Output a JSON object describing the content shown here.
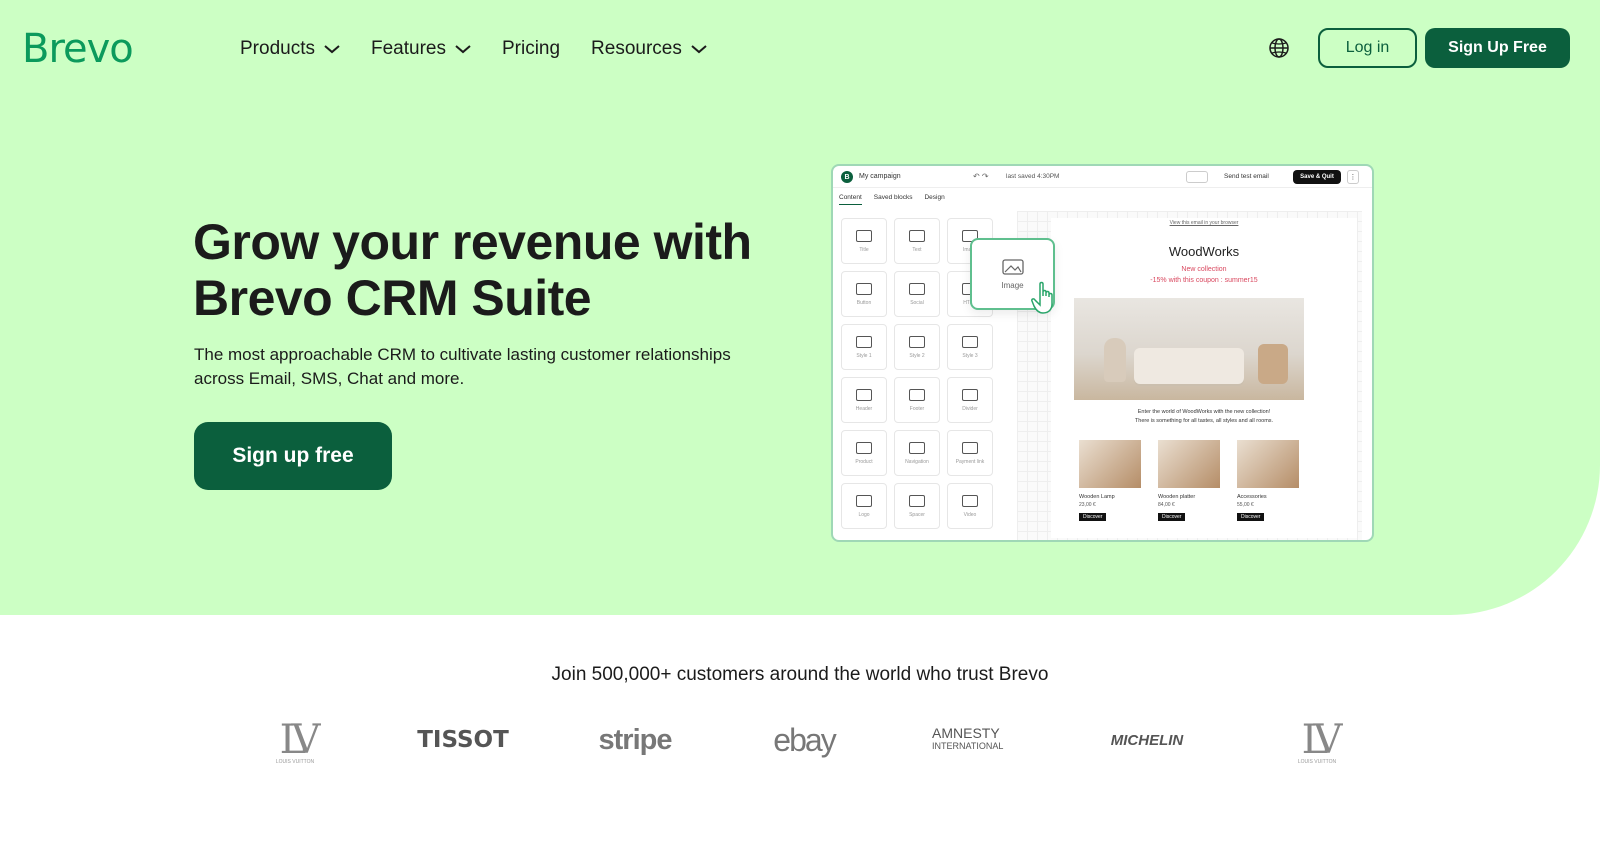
{
  "brand": {
    "logo_text": "Brevo",
    "accent": "#0b9a5c",
    "dark": "#0b5f3d",
    "hero_bg": "#ccffc4"
  },
  "nav": {
    "items": [
      {
        "label": "Products",
        "dropdown": true
      },
      {
        "label": "Features",
        "dropdown": true
      },
      {
        "label": "Pricing",
        "dropdown": false
      },
      {
        "label": "Resources",
        "dropdown": true
      }
    ],
    "globe_icon": "globe-icon",
    "login_label": "Log in",
    "signup_label": "Sign Up Free"
  },
  "hero": {
    "headline": "Grow your revenue with Brevo CRM Suite",
    "subtext": "The most approachable CRM to cultivate lasting customer relationships across Email, SMS, Chat and more.",
    "cta_label": "Sign up free"
  },
  "editor": {
    "badge": "B",
    "title": "My campaign",
    "last_saved": "last saved 4:30PM",
    "send_test": "Send test email",
    "save_quit": "Save & Quit",
    "more": "⋮",
    "tabs": [
      "Content",
      "Saved blocks",
      "Design"
    ],
    "blocks": [
      "Title",
      "Text",
      "Image",
      "Button",
      "Social",
      "HTML",
      "Style 1",
      "Style 2",
      "Style 3",
      "Header",
      "Footer",
      "Divider",
      "Product",
      "Navigation",
      "Payment link",
      "Logo",
      "Spacer",
      "Video"
    ],
    "drag_label": "Image",
    "email": {
      "view_link": "View this email in your browser",
      "brand_name": "WoodWorks",
      "promo_line1": "New collection",
      "promo_line2": "-15% with this coupon : summer15",
      "desc_line1": "Enter the world of WoodWorks with the new collection!",
      "desc_line2": "There is something for all tastes, all styles and all rooms.",
      "products": [
        {
          "name": "Wooden Lamp",
          "price": "23,00 €",
          "button": "Discover"
        },
        {
          "name": "Wooden platter",
          "price": "84,00 €",
          "button": "Discover"
        },
        {
          "name": "Accessories",
          "price": "55,00 €",
          "button": "Discover"
        }
      ]
    }
  },
  "trust": {
    "heading": "Join 500,000+ customers around the world who trust Brevo",
    "logos": [
      {
        "name": "Louis Vuitton",
        "text": "LV",
        "sub": "LOUIS VUITTON"
      },
      {
        "name": "Tissot",
        "text": "TISSOT"
      },
      {
        "name": "Stripe",
        "text": "stripe"
      },
      {
        "name": "eBay",
        "text": "ebay"
      },
      {
        "name": "Amnesty International",
        "text": "AMNESTY",
        "sub": "INTERNATIONAL"
      },
      {
        "name": "Michelin",
        "text": "MICHELIN"
      },
      {
        "name": "Louis Vuitton",
        "text": "LV",
        "sub": "LOUIS VUITTON"
      }
    ]
  }
}
